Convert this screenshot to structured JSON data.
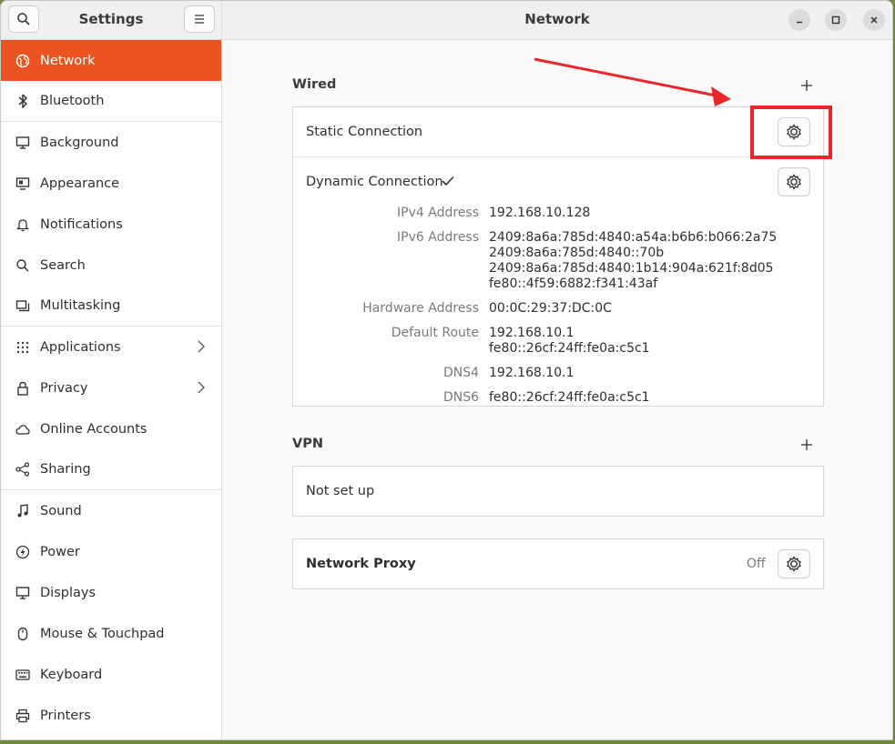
{
  "sidebar": {
    "title": "Settings",
    "items": [
      {
        "label": "Network",
        "icon": "globe-icon"
      },
      {
        "label": "Bluetooth",
        "icon": "bluetooth-icon"
      },
      {
        "label": "Background",
        "icon": "monitor-icon"
      },
      {
        "label": "Appearance",
        "icon": "appearance-icon"
      },
      {
        "label": "Notifications",
        "icon": "bell-icon"
      },
      {
        "label": "Search",
        "icon": "search-icon"
      },
      {
        "label": "Multitasking",
        "icon": "multitasking-icon"
      },
      {
        "label": "Applications",
        "icon": "grid-icon"
      },
      {
        "label": "Privacy",
        "icon": "lock-icon"
      },
      {
        "label": "Online Accounts",
        "icon": "cloud-icon"
      },
      {
        "label": "Sharing",
        "icon": "share-icon"
      },
      {
        "label": "Sound",
        "icon": "music-note-icon"
      },
      {
        "label": "Power",
        "icon": "power-icon"
      },
      {
        "label": "Displays",
        "icon": "display-icon"
      },
      {
        "label": "Mouse & Touchpad",
        "icon": "mouse-icon"
      },
      {
        "label": "Keyboard",
        "icon": "keyboard-icon"
      },
      {
        "label": "Printers",
        "icon": "printer-icon"
      }
    ]
  },
  "header": {
    "title": "Network"
  },
  "wired": {
    "title": "Wired",
    "static": {
      "label": "Static Connection"
    },
    "dynamic": {
      "label": "Dynamic Connection",
      "details": {
        "ipv4_key": "IPv4 Address",
        "ipv4": "192.168.10.128",
        "ipv6_key": "IPv6 Address",
        "ipv6_1": "2409:8a6a:785d:4840:a54a:b6b6:b066:2a75",
        "ipv6_2": "2409:8a6a:785d:4840::70b",
        "ipv6_3": "2409:8a6a:785d:4840:1b14:904a:621f:8d05",
        "ipv6_4": "fe80::4f59:6882:f341:43af",
        "hw_key": "Hardware Address",
        "hw": "00:0C:29:37:DC:0C",
        "route_key": "Default Route",
        "route_1": "192.168.10.1",
        "route_2": "fe80::26cf:24ff:fe0a:c5c1",
        "dns4_key": "DNS4",
        "dns4": "192.168.10.1",
        "dns6_key": "DNS6",
        "dns6": "fe80::26cf:24ff:fe0a:c5c1"
      }
    }
  },
  "vpn": {
    "title": "VPN",
    "status": "Not set up"
  },
  "proxy": {
    "label": "Network Proxy",
    "status": "Off"
  },
  "colors": {
    "accent": "#e95420",
    "annotation": "#e8262b"
  }
}
